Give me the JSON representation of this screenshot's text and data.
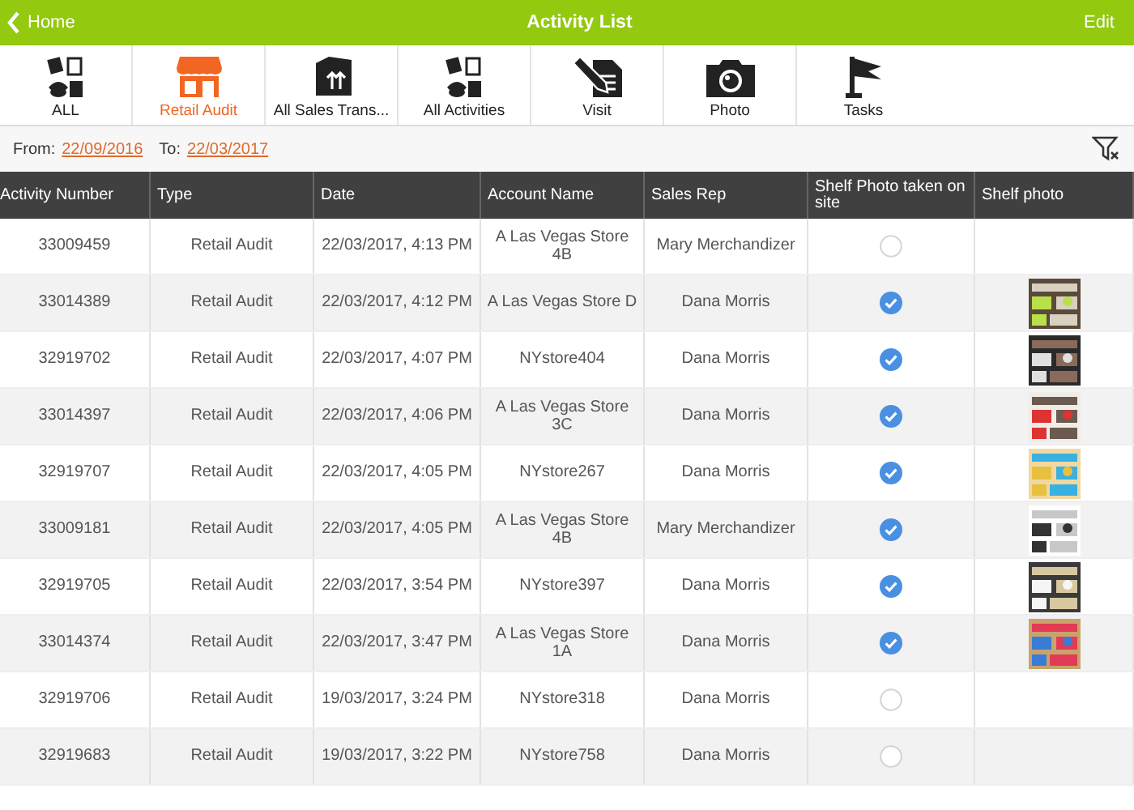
{
  "nav": {
    "back": "Home",
    "title": "Activity List",
    "action": "Edit"
  },
  "tabs": [
    {
      "label": "ALL",
      "kind": "all",
      "selected": false
    },
    {
      "label": "Retail Audit",
      "kind": "store",
      "selected": true
    },
    {
      "label": "All Sales Trans...",
      "kind": "box",
      "selected": false
    },
    {
      "label": "All Activities",
      "kind": "all",
      "selected": false
    },
    {
      "label": "Visit",
      "kind": "visit",
      "selected": false
    },
    {
      "label": "Photo",
      "kind": "camera",
      "selected": false
    },
    {
      "label": "Tasks",
      "kind": "flag",
      "selected": false
    }
  ],
  "filter": {
    "from_label": "From:",
    "from": "22/09/2016",
    "to_label": "To:",
    "to": "22/03/2017"
  },
  "table": {
    "columns": [
      "Activity Number",
      "Type",
      "Date",
      "Account Name",
      "Sales Rep",
      "Shelf Photo taken on site",
      "Shelf photo"
    ],
    "rows": [
      {
        "number": "33009459",
        "type": "Retail Audit",
        "date": "22/03/2017, 4:13 PM",
        "account": "A Las Vegas Store 4B",
        "rep": "Mary Merchandizer",
        "taken": false
      },
      {
        "number": "33014389",
        "type": "Retail Audit",
        "date": "22/03/2017, 4:12 PM",
        "account": "A Las Vegas Store D",
        "rep": "Dana Morris",
        "taken": true
      },
      {
        "number": "32919702",
        "type": "Retail Audit",
        "date": "22/03/2017, 4:07 PM",
        "account": "NYstore404",
        "rep": "Dana Morris",
        "taken": true
      },
      {
        "number": "33014397",
        "type": "Retail Audit",
        "date": "22/03/2017, 4:06 PM",
        "account": "A Las Vegas Store 3C",
        "rep": "Dana Morris",
        "taken": true
      },
      {
        "number": "32919707",
        "type": "Retail Audit",
        "date": "22/03/2017, 4:05 PM",
        "account": "NYstore267",
        "rep": "Dana Morris",
        "taken": true
      },
      {
        "number": "33009181",
        "type": "Retail Audit",
        "date": "22/03/2017, 4:05 PM",
        "account": "A Las Vegas Store 4B",
        "rep": "Mary Merchandizer",
        "taken": true
      },
      {
        "number": "32919705",
        "type": "Retail Audit",
        "date": "22/03/2017, 3:54 PM",
        "account": "NYstore397",
        "rep": "Dana Morris",
        "taken": true
      },
      {
        "number": "33014374",
        "type": "Retail Audit",
        "date": "22/03/2017, 3:47 PM",
        "account": "A Las Vegas Store 1A",
        "rep": "Dana Morris",
        "taken": true
      },
      {
        "number": "32919706",
        "type": "Retail Audit",
        "date": "19/03/2017, 3:24 PM",
        "account": "NYstore318",
        "rep": "Dana Morris",
        "taken": false
      },
      {
        "number": "32919683",
        "type": "Retail Audit",
        "date": "19/03/2017, 3:22 PM",
        "account": "NYstore758",
        "rep": "Dana Morris",
        "taken": false
      }
    ]
  }
}
